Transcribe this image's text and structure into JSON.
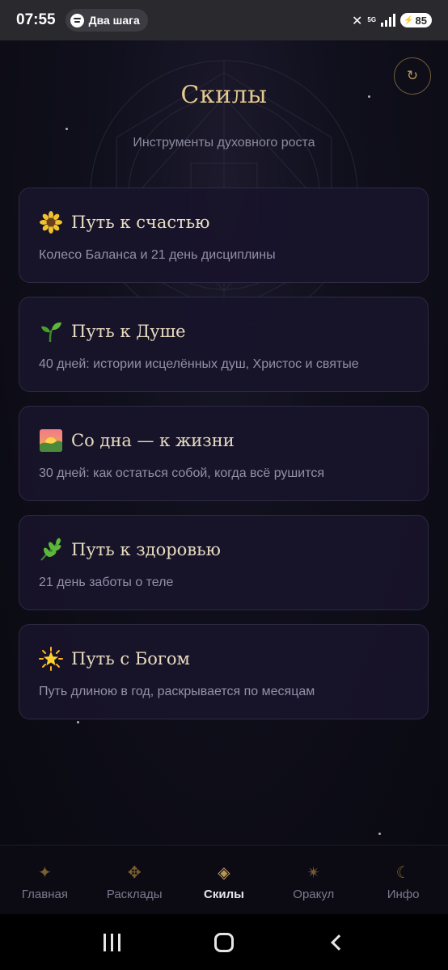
{
  "status_bar": {
    "time": "07:55",
    "app_pill": "Два шага",
    "network": "5G",
    "battery": "85"
  },
  "header": {
    "title": "Скилы",
    "subtitle": "Инструменты духовного роста"
  },
  "cards": [
    {
      "icon": "sunflower-icon",
      "title": "Путь к счастью",
      "desc": "Колесо Баланса и 21 день дисциплины"
    },
    {
      "icon": "seedling-icon",
      "title": "Путь к Душе",
      "desc": "40 дней: истории исцелённых душ, Христос и святые"
    },
    {
      "icon": "sunrise-icon",
      "title": "Со дна — к жизни",
      "desc": "30 дней: как остаться собой, когда всё рушится"
    },
    {
      "icon": "herb-icon",
      "title": "Путь к здоровью",
      "desc": "21 день заботы о теле"
    },
    {
      "icon": "glowing-star-icon",
      "title": "Путь с Богом",
      "desc": "Путь длиною в год, раскрывается по месяцам"
    }
  ],
  "bottom_nav": {
    "items": [
      {
        "label": "Главная",
        "icon": "sparkle-icon",
        "glyph": "✦"
      },
      {
        "label": "Расклады",
        "icon": "cards-spread-icon",
        "glyph": "✥"
      },
      {
        "label": "Скилы",
        "icon": "diamond-icon",
        "glyph": "◈"
      },
      {
        "label": "Оракул",
        "icon": "star-burst-icon",
        "glyph": "✴"
      },
      {
        "label": "Инфо",
        "icon": "moon-icon",
        "glyph": "☾"
      }
    ],
    "active": "Скилы"
  },
  "colors": {
    "accent_gold": "#e4c98f",
    "icon_gold": "#b8965a",
    "card_bg": "#18142a",
    "muted_text": "#9490a8"
  }
}
